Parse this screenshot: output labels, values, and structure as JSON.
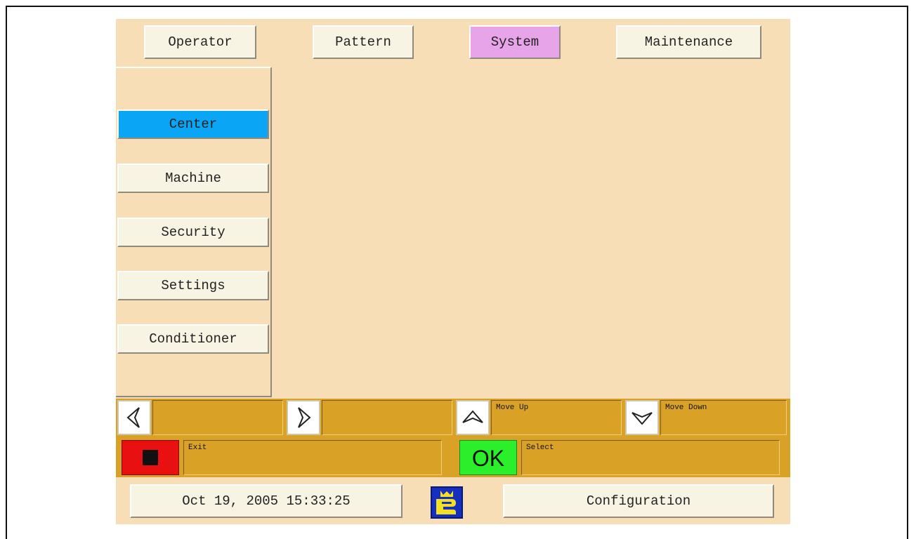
{
  "tabs": [
    {
      "label": "Operator"
    },
    {
      "label": "Pattern"
    },
    {
      "label": "System"
    },
    {
      "label": "Maintenance"
    }
  ],
  "active_tab": "System",
  "sidebar": {
    "items": [
      {
        "label": "Center"
      },
      {
        "label": "Machine"
      },
      {
        "label": "Security"
      },
      {
        "label": "Settings"
      },
      {
        "label": "Conditioner"
      }
    ],
    "active_item": "Center"
  },
  "softkeys": {
    "left_label": "",
    "right_label": "",
    "up_label": "Move Up",
    "down_label": "Move Down",
    "exit_label": "Exit",
    "ok_key": "OK",
    "select_label": "Select"
  },
  "status": {
    "datetime": "Oct 19, 2005 15:33:25",
    "screen_name": "Configuration"
  },
  "icons": {
    "left": "arrow-left-icon",
    "right": "arrow-right-icon",
    "up": "arrow-up-icon",
    "down": "arrow-down-icon",
    "exit": "stop-icon",
    "ok": "ok-icon",
    "logo": "brand-logo-icon"
  },
  "colors": {
    "background": "#f8deb6",
    "active_tab": "#e8a4e8",
    "active_sidebar": "#0aa6f5",
    "softkey_bar": "#d9a227",
    "exit_key": "#e81010",
    "ok_key": "#2bef2b",
    "logo_blue": "#1530c0",
    "logo_yellow": "#f4e020"
  }
}
